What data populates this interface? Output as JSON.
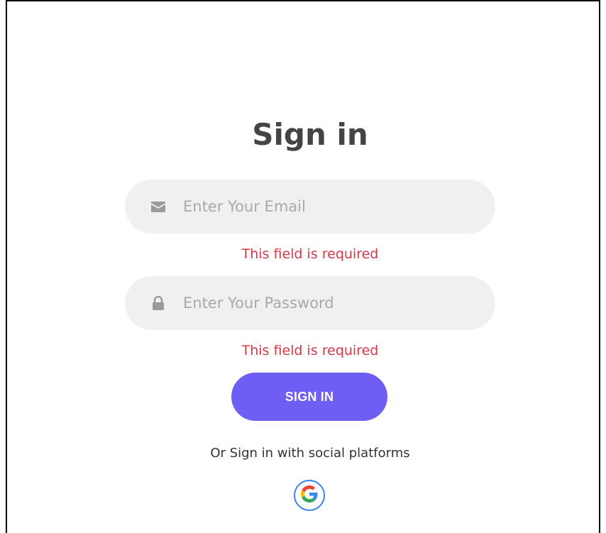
{
  "form": {
    "title": "Sign in",
    "email": {
      "placeholder": "Enter Your Email",
      "value": "",
      "error": "This field is required",
      "icon": "envelope-icon"
    },
    "password": {
      "placeholder": "Enter Your Password",
      "value": "",
      "error": "This field is required",
      "icon": "lock-icon"
    },
    "submit_label": "SIGN IN",
    "social_text": "Or Sign in with social platforms",
    "social_icons": [
      "google-icon"
    ]
  },
  "colors": {
    "title": "#444444",
    "field_bg": "#f0f0f0",
    "error": "#dc3545",
    "button": "#6f5ef3",
    "google_ring": "#3b82f6"
  }
}
